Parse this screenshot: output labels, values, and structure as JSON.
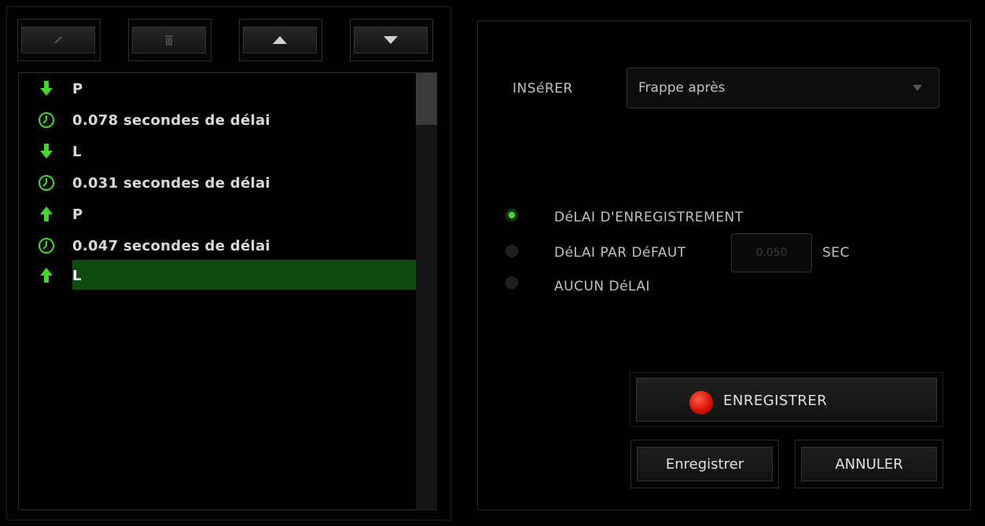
{
  "toolbar": {
    "edit_icon": "pencil-icon",
    "delete_icon": "trash-icon",
    "up_icon": "arrow-up-icon",
    "down_icon": "arrow-down-icon"
  },
  "macro_list": {
    "items": [
      {
        "type": "key-down",
        "icon": "key-down-arrow-icon",
        "text": "P"
      },
      {
        "type": "delay",
        "icon": "clock-icon",
        "text": "0.078 secondes de délai"
      },
      {
        "type": "key-down",
        "icon": "key-down-arrow-icon",
        "text": "L"
      },
      {
        "type": "delay",
        "icon": "clock-icon",
        "text": "0.031 secondes de délai"
      },
      {
        "type": "key-up",
        "icon": "key-up-arrow-icon",
        "text": "P"
      },
      {
        "type": "delay",
        "icon": "clock-icon",
        "text": "0.047 secondes de délai"
      },
      {
        "type": "key-up",
        "icon": "key-up-arrow-icon",
        "text": "L",
        "selected": true
      }
    ]
  },
  "insert": {
    "label": "INSéRER",
    "selected": "Frappe après"
  },
  "delay_options": {
    "record_label": "DéLAI D'ENREGISTREMENT",
    "default_label": "DéLAI PAR DéFAUT",
    "none_label": "AUCUN DéLAI",
    "default_value": "0.050",
    "unit": "SEC",
    "selected": "record"
  },
  "buttons": {
    "record": "ENREGISTRER",
    "save": "Enregistrer",
    "cancel": "ANNULER"
  },
  "colors": {
    "accent": "#44d62c",
    "selection": "#0f4a0f",
    "record": "#e01400"
  }
}
